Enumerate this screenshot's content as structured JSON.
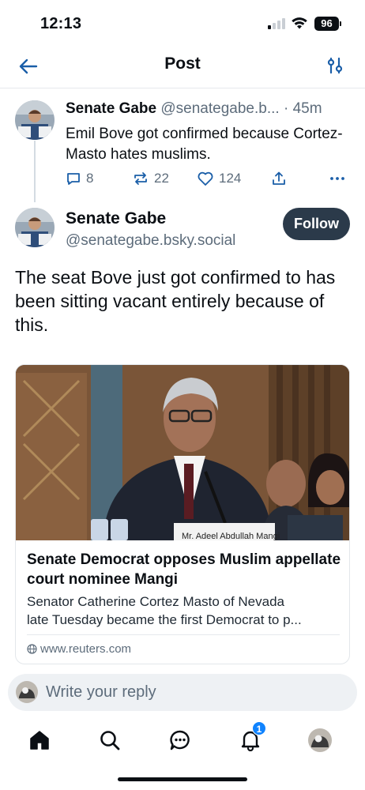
{
  "status_bar": {
    "time": "12:13",
    "battery": "96"
  },
  "nav": {
    "title": "Post"
  },
  "parent_post": {
    "author_name": "Senate Gabe",
    "handle": "@senategabe.b...",
    "time_sep": "·",
    "time": "45m",
    "text": "Emil Bove got confirmed because Cortez-Masto hates muslims.",
    "replies": "8",
    "reposts": "22",
    "likes": "124"
  },
  "main_post": {
    "author_name": "Senate Gabe",
    "handle": "@senategabe.bsky.social",
    "follow_label": "Follow",
    "text": "The seat Bove just got confirmed to has been sitting vacant entirely because of this."
  },
  "link_card": {
    "image_caption": "Mr. Adeel Abdullah Mangi",
    "title": "Senate Democrat opposes Muslim appellate court nominee Mangi",
    "description_line1": "Senator Catherine Cortez Masto of Nevada",
    "description_line2": "late Tuesday became the first Democrat to p...",
    "domain": "www.reuters.com"
  },
  "reply_bar": {
    "placeholder": "Write your reply"
  },
  "tab_bar": {
    "tabs": [
      "home-icon",
      "search-icon",
      "chat-icon",
      "bell-icon",
      "profile-avatar"
    ],
    "notifications_badge": "1"
  },
  "colors": {
    "follow_button": "#2b3a4a",
    "badge": "#1083fe",
    "muted_text": "#5d6c7b"
  }
}
